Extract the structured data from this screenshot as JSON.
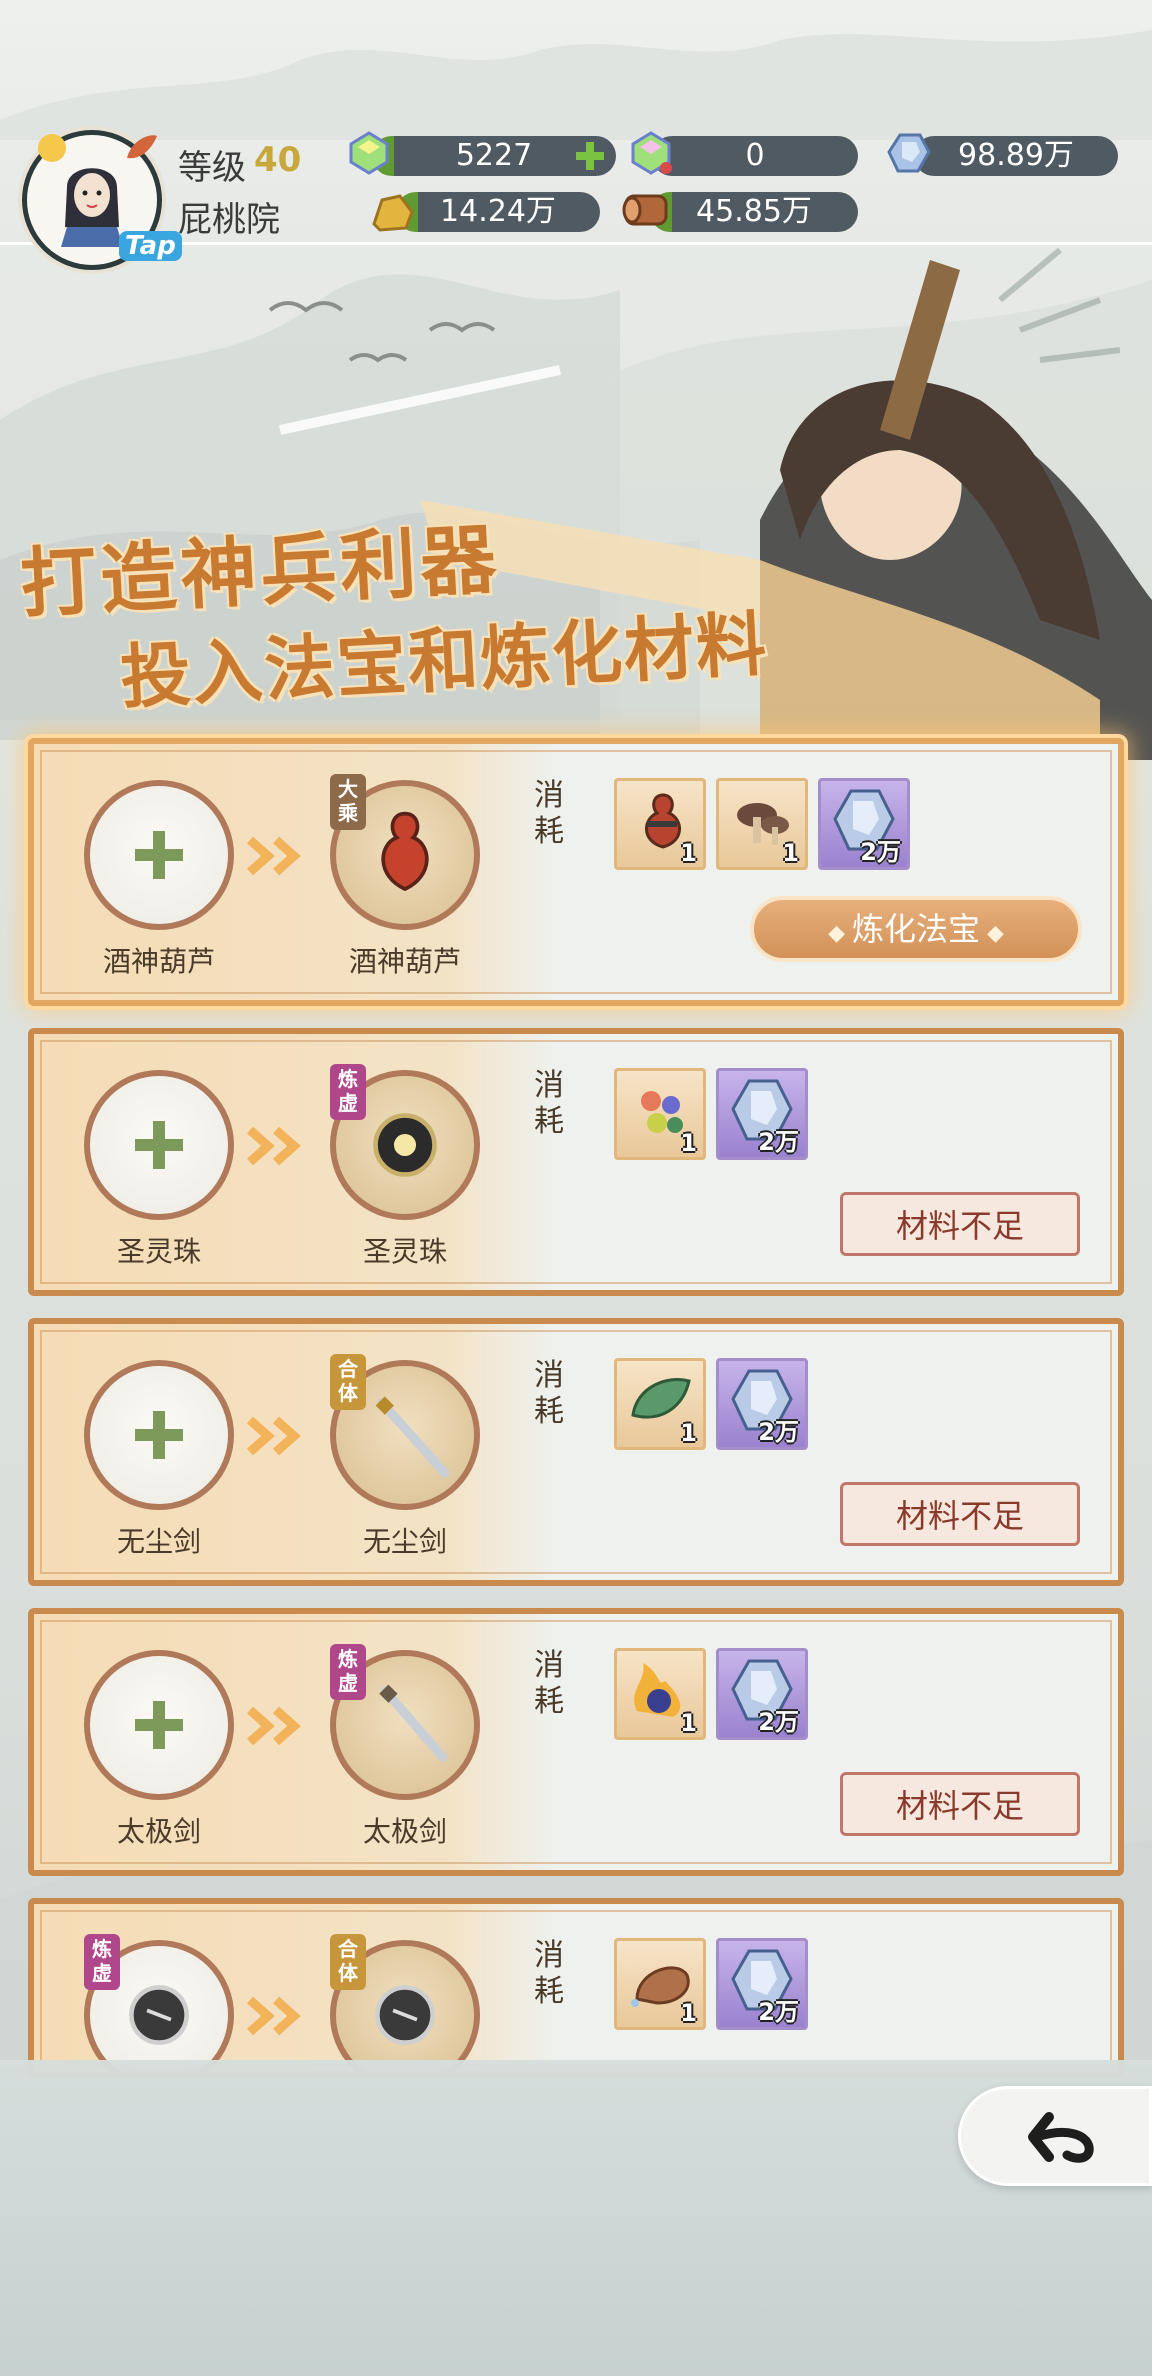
{
  "player": {
    "level_label": "等级",
    "level": "40",
    "name": "屁桃院",
    "tap_badge": "Tap"
  },
  "resources": {
    "gem1": "5227",
    "gem2": "0",
    "crystal": "98.89万",
    "ore": "14.24万",
    "wood": "45.85万"
  },
  "banner": {
    "line1": "打造神兵利器",
    "line2": "投入法宝和炼化材料"
  },
  "cost_label": "消耗",
  "recipes": [
    {
      "material_name": "酒神葫芦",
      "product_name": "酒神葫芦",
      "rank": "大乘",
      "rank_color": "#8c6a4a",
      "costs": [
        {
          "icon": "gourd-icon",
          "count": "1"
        },
        {
          "icon": "mushroom-icon",
          "count": "1"
        },
        {
          "icon": "crystal-icon",
          "count": "2万"
        }
      ],
      "button": "炼化法宝",
      "button_state": "primary"
    },
    {
      "material_name": "圣灵珠",
      "product_name": "圣灵珠",
      "rank": "炼虚",
      "rank_color": "#b0478a",
      "costs": [
        {
          "icon": "stones-icon",
          "count": "1"
        },
        {
          "icon": "crystal-icon",
          "count": "2万"
        }
      ],
      "button": "材料不足",
      "button_state": "disabled"
    },
    {
      "material_name": "无尘剑",
      "product_name": "无尘剑",
      "rank": "合体",
      "rank_color": "#c8963a",
      "costs": [
        {
          "icon": "leaf-icon",
          "count": "1"
        },
        {
          "icon": "crystal-icon",
          "count": "2万"
        }
      ],
      "button": "材料不足",
      "button_state": "disabled"
    },
    {
      "material_name": "太极剑",
      "product_name": "太极剑",
      "rank": "炼虚",
      "rank_color": "#b0478a",
      "costs": [
        {
          "icon": "flame-orb-icon",
          "count": "1"
        },
        {
          "icon": "crystal-icon",
          "count": "2万"
        }
      ],
      "button": "材料不足",
      "button_state": "disabled"
    },
    {
      "material_name": "",
      "product_name": "",
      "rank": "合体",
      "material_rank": "炼虚",
      "rank_color": "#c8963a",
      "costs": [
        {
          "icon": "shell-icon",
          "count": "1"
        },
        {
          "icon": "crystal-icon",
          "count": "2万"
        }
      ],
      "button": "",
      "button_state": "disabled"
    }
  ]
}
